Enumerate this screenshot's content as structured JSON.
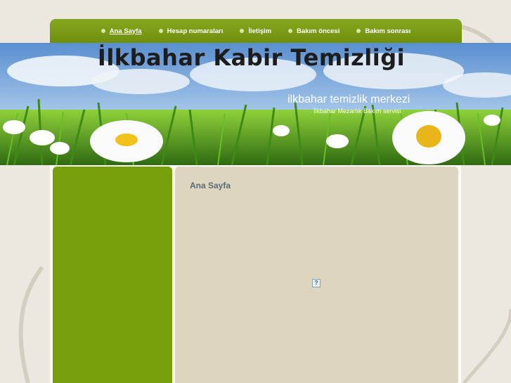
{
  "nav": {
    "items": [
      {
        "label": "Ana Sayfa",
        "active": true
      },
      {
        "label": "Hesap numaraları",
        "active": false
      },
      {
        "label": "İletişim",
        "active": false
      },
      {
        "label": "Bakım öncesi",
        "active": false
      },
      {
        "label": "Bakım sonrası",
        "active": false
      }
    ]
  },
  "header": {
    "title": "İlkbahar Kabir Temizliği",
    "subtitle": "ilkbahar temizlik merkezi",
    "tagline": "İlkbahar Mezarlık Bakım servisi"
  },
  "main": {
    "title": "Ana Sayfa",
    "image_icon": "broken-image-icon"
  },
  "colors": {
    "nav_green": "#7a9c14",
    "sidebar_green": "#77a00a",
    "content_beige": "#ddd5c0",
    "page_bg": "#ece8e0"
  }
}
